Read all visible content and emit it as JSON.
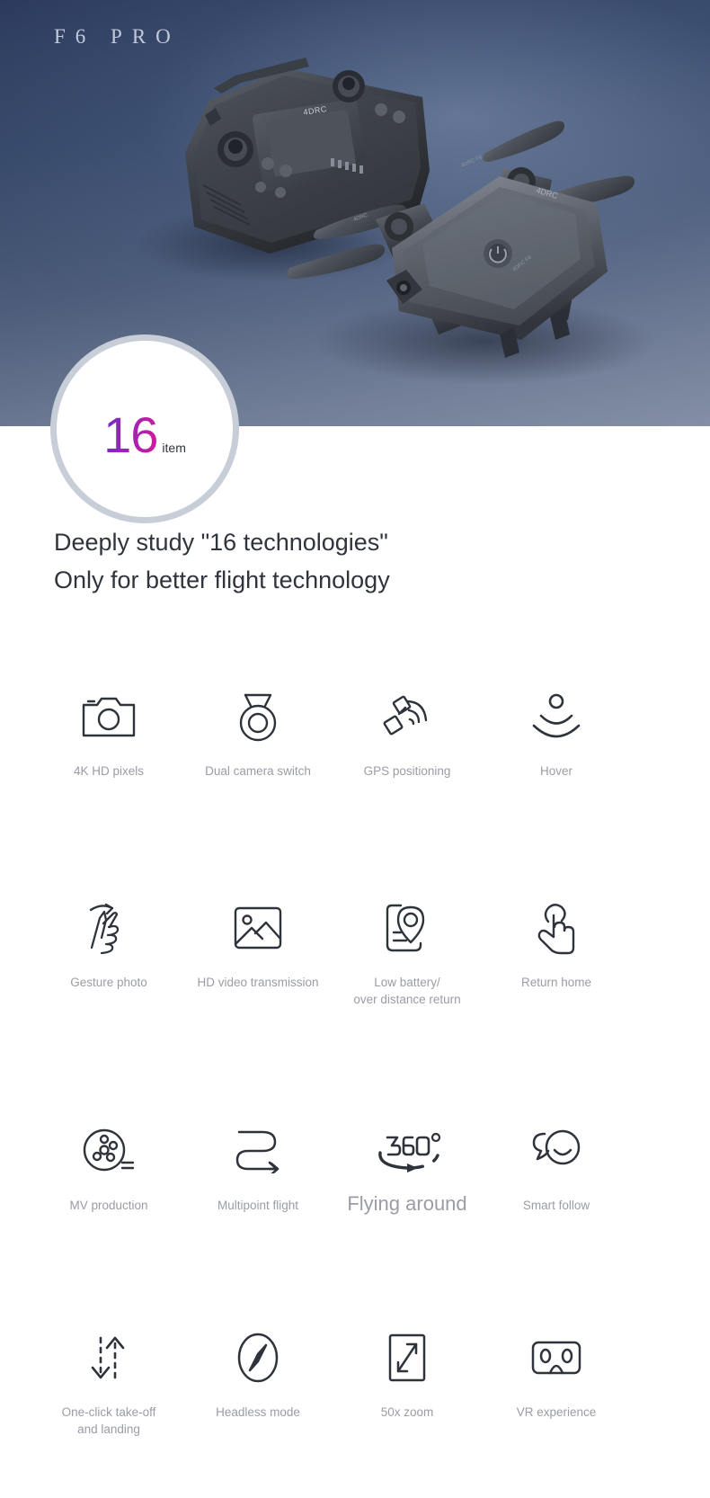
{
  "hero": {
    "title": "F 6   P R O",
    "title_plain": "F6 PRO",
    "product_brand": "4DRC",
    "background_colors": [
      "#2b3a5c",
      "#4b5b79",
      "#848fa5"
    ]
  },
  "badge": {
    "number": "16",
    "unit": "item",
    "gradient_from": "#6e2ec4",
    "gradient_to": "#d21a9c",
    "ring_color": "#c8ced8"
  },
  "headline": {
    "line1": "Deeply study \"16 technologies\"",
    "line2": "Only for better flight technology",
    "color": "#30343d"
  },
  "features": {
    "label_color": "#9a9ca6",
    "icon_color": "#2f333b",
    "rows": [
      [
        {
          "icon": "camera-icon",
          "label": "4K HD pixels"
        },
        {
          "icon": "dual-camera-icon",
          "label": "Dual camera switch"
        },
        {
          "icon": "satellite-gps-icon",
          "label": "GPS positioning"
        },
        {
          "icon": "hover-waves-icon",
          "label": "Hover"
        }
      ],
      [
        {
          "icon": "gesture-hand-icon",
          "label": "Gesture photo"
        },
        {
          "icon": "image-transmission-icon",
          "label": "HD video transmission"
        },
        {
          "icon": "location-return-icon",
          "label": "Low battery/\nover distance return"
        },
        {
          "icon": "touch-finger-icon",
          "label": "Return home"
        }
      ],
      [
        {
          "icon": "film-reel-icon",
          "label": "MV production"
        },
        {
          "icon": "waypoint-route-icon",
          "label": "Multipoint flight"
        },
        {
          "icon": "orbit-360-icon",
          "label": "Flying around",
          "emphasis": true
        },
        {
          "icon": "smart-follow-icon",
          "label": "Smart follow"
        }
      ],
      [
        {
          "icon": "takeoff-landing-icon",
          "label": "One-click take-off\nand landing"
        },
        {
          "icon": "compass-icon",
          "label": "Headless mode"
        },
        {
          "icon": "zoom-expand-icon",
          "label": "50x zoom"
        },
        {
          "icon": "vr-goggles-icon",
          "label": "VR experience"
        }
      ]
    ]
  },
  "icon_labels": {
    "orbit_360_text": "360",
    "orbit_360_degree": "°"
  }
}
